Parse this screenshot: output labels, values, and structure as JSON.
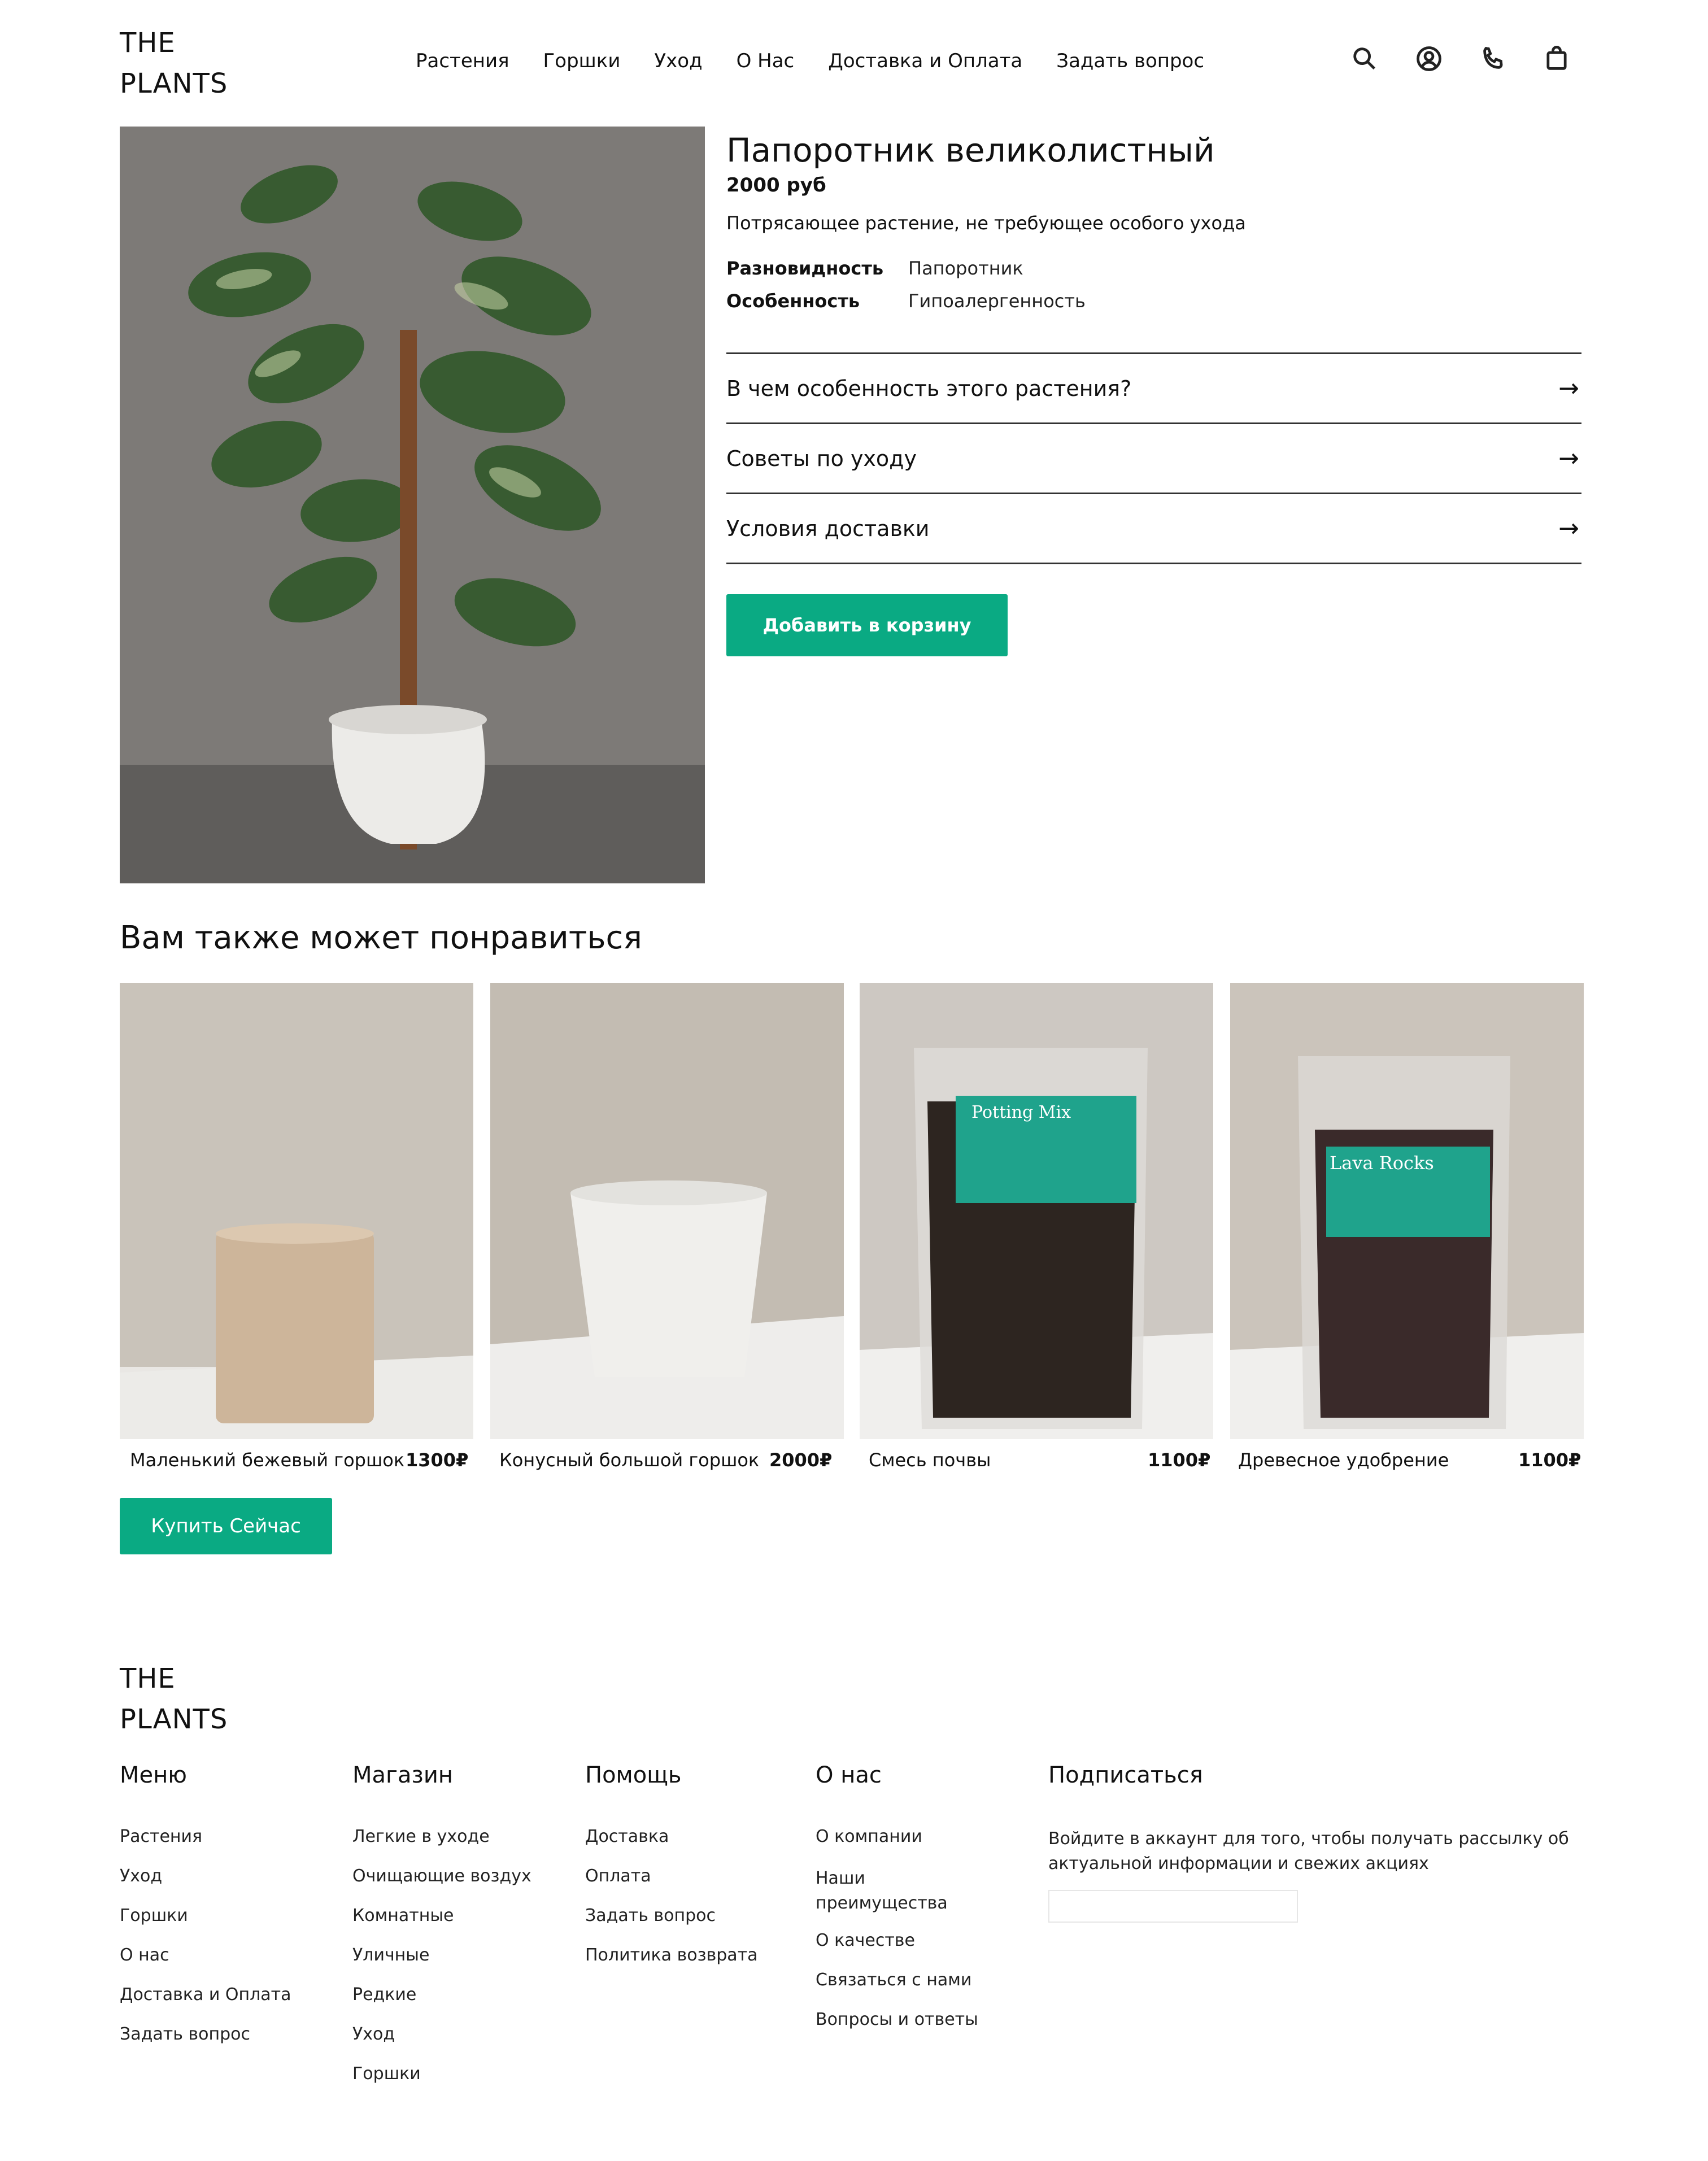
{
  "header": {
    "logo_line1": "THE",
    "logo_line2": "PLANTS",
    "nav": [
      "Растения",
      "Горшки",
      "Уход",
      "О Нас",
      "Доставка и Оплата",
      "Задать вопрос"
    ],
    "icons": [
      "search-icon",
      "user-icon",
      "phone-icon",
      "shopping-bag-icon"
    ]
  },
  "product": {
    "title": "Папоротник великолистный",
    "price": "2000 руб",
    "description": "Потрясающее растение, не требующее особого ухода",
    "specs": [
      {
        "key": "Разновидность",
        "value": "Папоротник"
      },
      {
        "key": "Особенность",
        "value": "Гипоалергенность"
      }
    ],
    "accordion": [
      "В чем особенность этого растения?",
      "Советы по уходу",
      "Условия доставки"
    ],
    "accordion_arrow": "→",
    "add_to_cart": "Добавить в корзину"
  },
  "recommendations": {
    "title": "Вам также может понравиться",
    "items": [
      {
        "name": "Маленький бежевый горшок",
        "price": "1300₽"
      },
      {
        "name": "Конусный большой горшок",
        "price": "2000₽"
      },
      {
        "name": "Смесь почвы",
        "price": "1100₽"
      },
      {
        "name": "Древесное удобрение",
        "price": "1100₽"
      }
    ],
    "bag_labels": [
      "Potting Mix",
      "Lava Rocks"
    ],
    "buy_now": "Купить Сейчас"
  },
  "footer": {
    "logo_line1": "THE",
    "logo_line2": "PLANTS",
    "columns": [
      {
        "title": "Меню",
        "links": [
          "Растения",
          "Уход",
          "Горшки",
          "О нас",
          "Доставка и Оплата",
          "Задать вопрос"
        ]
      },
      {
        "title": "Магазин",
        "links": [
          "Легкие в уходе",
          "Очищающие воздух",
          "Комнатные",
          "Уличные",
          "Редкие",
          "Уход",
          "Горшки"
        ]
      },
      {
        "title": "Помощь",
        "links": [
          "Доставка",
          "Оплата",
          "Задать вопрос",
          "Политика возврата"
        ]
      },
      {
        "title": "О нас",
        "links": [
          "О компании",
          "Наши преимущества",
          "О качестве",
          "Связаться с нами",
          "Вопросы и ответы"
        ]
      }
    ],
    "subscribe": {
      "title": "Подписаться",
      "text": "Войдите в аккаунт для того, чтобы получать рассылку об актуальной информации и свежих акциях",
      "input_placeholder": ""
    }
  },
  "colors": {
    "accent": "#0aaa83",
    "text": "#111111"
  }
}
